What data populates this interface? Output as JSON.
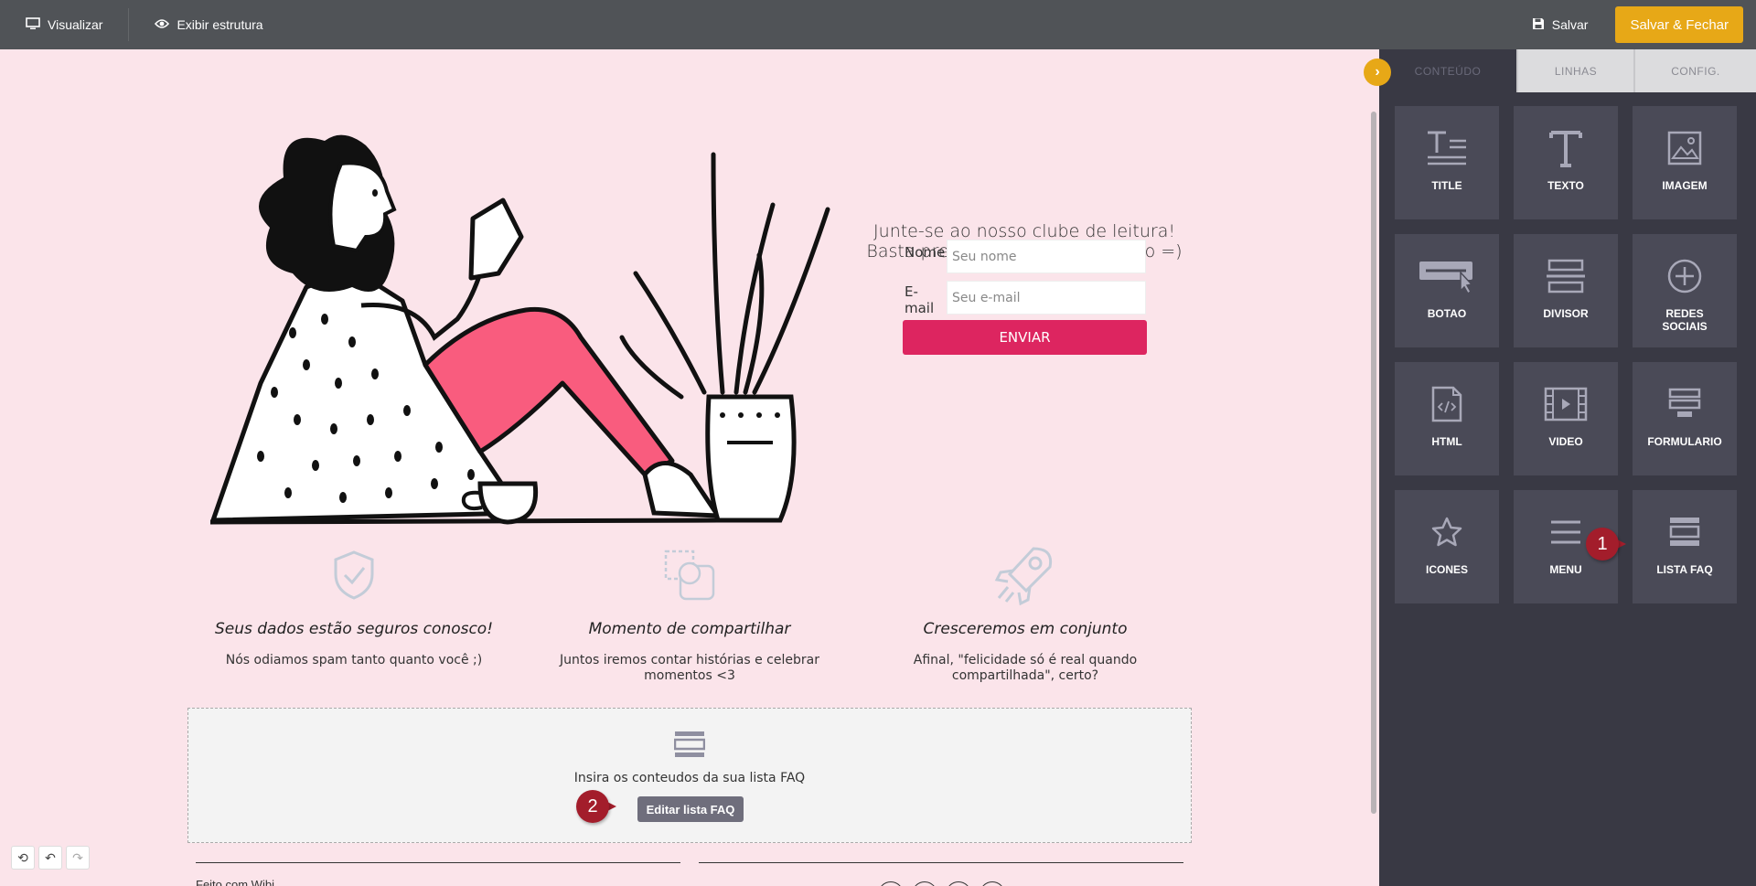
{
  "topbar": {
    "preview_label": "Visualizar",
    "structure_label": "Exibir estrutura",
    "save_label": "Salvar",
    "save_close_label": "Salvar & Fechar",
    "accent_color": "#e7a817"
  },
  "hero": {
    "line1": "Junte-se ao nosso clube de leitura!",
    "line2": "Basta preencher os dados abaixo =)",
    "name_label": "Nome",
    "name_placeholder": "Seu nome",
    "email_label": "E-mail",
    "email_placeholder": "Seu e-mail",
    "submit_label": "ENVIAR",
    "submit_color": "#dd2560"
  },
  "features": [
    {
      "icon": "shield-check-icon",
      "title": "Seus dados estão seguros conosco!",
      "desc": "Nós odiamos spam tanto quanto você ;)"
    },
    {
      "icon": "share-shapes-icon",
      "title": "Momento de compartilhar",
      "desc": "Juntos iremos contar histórias e celebrar momentos <3"
    },
    {
      "icon": "rocket-icon",
      "title": "Cresceremos em conjunto",
      "desc": "Afinal, \"felicidade só é real quando compartilhada\", certo?"
    }
  ],
  "faq": {
    "icon": "faq-list-icon",
    "text": "Insira os conteudos da sua lista FAQ",
    "button_label": "Editar lista FAQ"
  },
  "footer": {
    "text": "Feito com Wibi"
  },
  "panel": {
    "tabs": [
      "CONTEÚDO",
      "LINHAS",
      "CONFIG."
    ],
    "tiles": [
      {
        "label": "TITLE",
        "icon": "title-icon"
      },
      {
        "label": "TEXTO",
        "icon": "text-icon"
      },
      {
        "label": "IMAGEM",
        "icon": "image-icon"
      },
      {
        "label": "BOTAO",
        "icon": "button-icon"
      },
      {
        "label": "DIVISOR",
        "icon": "divider-icon"
      },
      {
        "label": "REDES",
        "label2": "SOCIAIS",
        "icon": "social-plus-icon"
      },
      {
        "label": "HTML",
        "icon": "html-file-icon"
      },
      {
        "label": "VIDEO",
        "icon": "video-icon"
      },
      {
        "label": "FORMULARIO",
        "icon": "form-icon"
      },
      {
        "label": "ICONES",
        "icon": "star-icon"
      },
      {
        "label": "MENU",
        "icon": "menu-icon"
      },
      {
        "label": "LISTA FAQ",
        "icon": "faq-list-icon"
      }
    ]
  },
  "annotations": {
    "badge1": "1",
    "badge2": "2",
    "badge_color": "#a31d2b"
  }
}
